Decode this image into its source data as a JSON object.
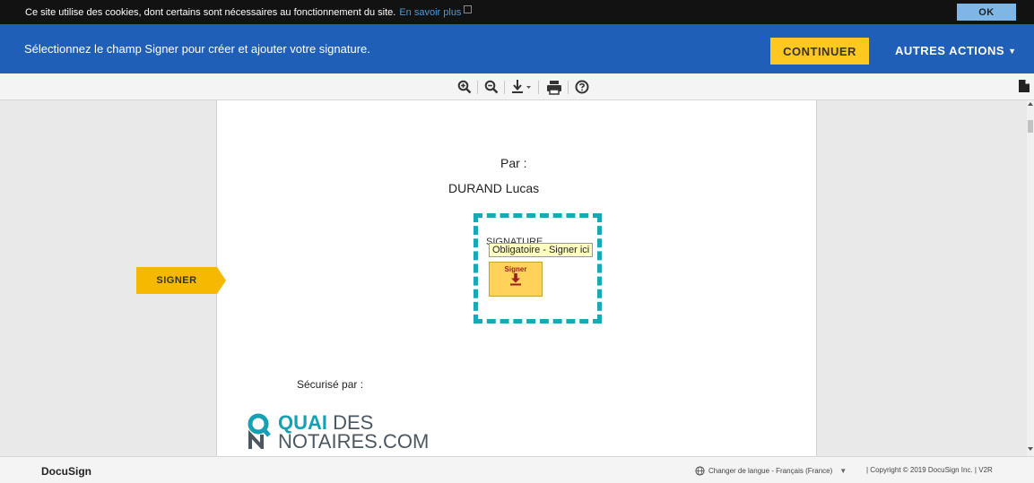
{
  "cookie_bar": {
    "message": "Ce site utilise des cookies, dont certains sont nécessaires au fonctionnement du site.",
    "link_label": "En savoir plus",
    "ok_label": "OK"
  },
  "action_bar": {
    "instruction": "Sélectionnez le champ Signer pour créer et ajouter votre signature.",
    "continue_label": "CONTINUER",
    "other_actions_label": "AUTRES ACTIONS",
    "other_actions_caret": "▼"
  },
  "toolbar": {
    "icons": [
      "zoom-in-icon",
      "zoom-out-icon",
      "download-icon",
      "print-icon",
      "help-icon",
      "page-icon"
    ]
  },
  "document": {
    "par_label": "Par :",
    "signer_name": "DURAND Lucas",
    "signature_caption": "SIGNATURE",
    "tooltip": "Obligatoire - Signer ici",
    "sign_tag_label": "Signer",
    "securise_label": "Sécurisé par :",
    "logo": {
      "line1_accent": "QUAI",
      "line1_rest": "DES",
      "line2": "NOTAIRES.COM"
    }
  },
  "signer_button": {
    "label": "SIGNER"
  },
  "footer": {
    "brand": "DocuSign",
    "language": "Changer de langue - Français (France)",
    "language_caret": "▼",
    "copyright": "| Copyright © 2019 DocuSign Inc. | V2R"
  },
  "colors": {
    "cookie_bar": "#121212",
    "action_bar": "#1f5fb7",
    "continue_button": "#ffc820",
    "signer_button": "#f6b800",
    "signature_box": "#17a9b6",
    "logo_accent": "#16a0b3"
  }
}
